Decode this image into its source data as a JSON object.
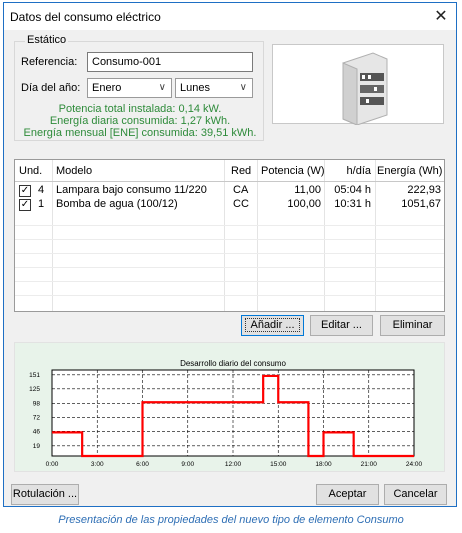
{
  "window": {
    "title": "Datos del consumo eléctrico",
    "close_icon": "close-icon"
  },
  "static_group": {
    "legend": "Estático",
    "ref_label": "Referencia:",
    "ref_value": "Consumo-001",
    "day_label": "Día del año:",
    "month_value": "Enero",
    "weekday_value": "Lunes",
    "summary": [
      "Potencia total instalada: 0,14 kW.",
      "Energía diaria consumida: 1,27 kWh.",
      "Energía mensual [ENE] consumida: 39,51 kWh."
    ]
  },
  "image_panel": {
    "icon": "electrical-panel-icon"
  },
  "table": {
    "columns": [
      "Und.",
      "Modelo",
      "Red",
      "Potencia (W)",
      "h/día",
      "Energía (Wh)"
    ],
    "rows": [
      {
        "checked": true,
        "und": "4",
        "modelo": "Lampara bajo consumo 11/220",
        "red": "CA",
        "potencia": "11,00",
        "hdia": "05:04 h",
        "energia": "222,93"
      },
      {
        "checked": true,
        "und": "1",
        "modelo": "Bomba de agua (100/12)",
        "red": "CC",
        "potencia": "100,00",
        "hdia": "10:31 h",
        "energia": "1051,67"
      }
    ]
  },
  "buttons": {
    "add": "Añadir ...",
    "edit": "Editar ...",
    "delete": "Eliminar",
    "labels": "Rotulación ...",
    "accept": "Aceptar",
    "cancel": "Cancelar"
  },
  "chart_data": {
    "type": "line",
    "title": "Desarrollo diario del consumo",
    "xlabel": "",
    "ylabel": "",
    "x_ticks": [
      "0:00",
      "3:00",
      "6:00",
      "9:00",
      "12:00",
      "15:00",
      "18:00",
      "21:00",
      "24:00"
    ],
    "y_ticks": [
      151,
      125,
      98,
      72,
      46,
      19
    ],
    "ylim": [
      0,
      160
    ],
    "xlim": [
      0,
      24
    ],
    "grid": true,
    "series": [
      {
        "color": "#ff0000",
        "points": [
          [
            0,
            44
          ],
          [
            2,
            44
          ],
          [
            2,
            0
          ],
          [
            6,
            0
          ],
          [
            6,
            100
          ],
          [
            14,
            100
          ],
          [
            14,
            149
          ],
          [
            15,
            149
          ],
          [
            15,
            100
          ],
          [
            17,
            100
          ],
          [
            17,
            0
          ],
          [
            18,
            0
          ],
          [
            18,
            44
          ],
          [
            20,
            44
          ],
          [
            20,
            0
          ],
          [
            24,
            0
          ]
        ]
      }
    ]
  },
  "caption": "Presentación de las propiedades del nuevo tipo de elemento Consumo"
}
